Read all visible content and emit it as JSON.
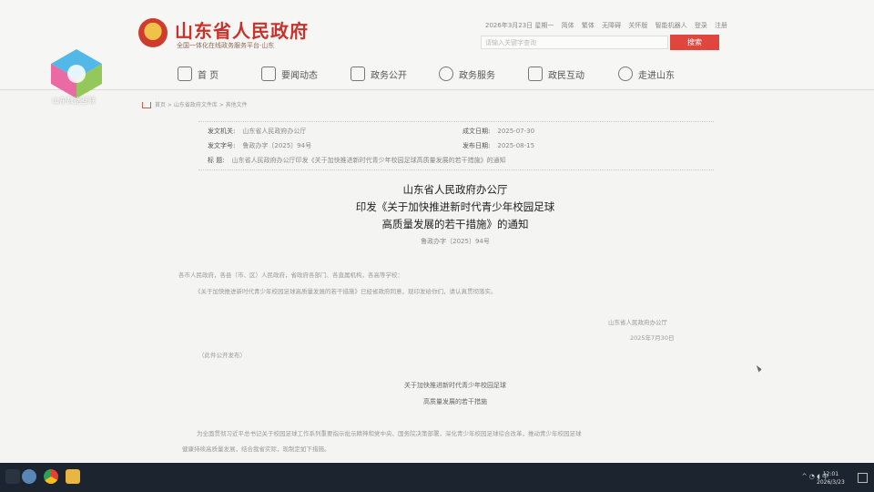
{
  "header": {
    "site_title": "山东省人民政府",
    "site_subtitle": "全国一体化在线政务服务平台·山东",
    "top_links": [
      "2026年3月23日 星期一",
      "简体",
      "繁体",
      "无障碍",
      "关怀版",
      "智能机器人",
      "登录",
      "注册"
    ],
    "search_placeholder": "请输入关键字查询",
    "search_button": "搜索"
  },
  "nav": {
    "items": [
      {
        "label": "首 页",
        "icon": "home-icon"
      },
      {
        "label": "要闻动态",
        "icon": "news-icon"
      },
      {
        "label": "政务公开",
        "icon": "document-icon"
      },
      {
        "label": "政务服务",
        "icon": "heart-icon"
      },
      {
        "label": "政民互动",
        "icon": "chat-icon"
      },
      {
        "label": "走进山东",
        "icon": "location-icon"
      }
    ]
  },
  "breadcrumb": "首页 > 山东省政府文件库 > 其他文件",
  "meta": {
    "issuer_label": "发文机关:",
    "issuer": "山东省人民政府办公厅",
    "docno_label": "发文字号:",
    "docno": "鲁政办字〔2025〕94号",
    "title_label": "标    题:",
    "title": "山东省人民政府办公厅印发《关于加快推进新时代青少年校园足球高质量发展的若干措施》的通知",
    "created_label": "成文日期:",
    "created": "2025-07-30",
    "published_label": "发布日期:",
    "published": "2025-08-15"
  },
  "document": {
    "title_lines": [
      "山东省人民政府办公厅",
      "印发《关于加快推进新时代青少年校园足球",
      "高质量发展的若干措施》的通知"
    ],
    "doc_number": "鲁政办字〔2025〕94号",
    "recipients": "各市人民政府，各县（市、区）人民政府，省政府各部门、各直属机构，各高等学校：",
    "body": "《关于加快推进新时代青少年校园足球高质量发展的若干措施》已经省政府同意，现印发给你们，请认真贯彻落实。",
    "signature": "山东省人民政府办公厅",
    "date": "2025年7月30日",
    "public_note": "（此件公开发布）",
    "attach_title_1": "关于加快推进新时代青少年校园足球",
    "attach_title_2": "高质量发展的若干措施",
    "para1": "为全面贯彻习近平总书记关于校园足球工作系列重要指示批示精神和党中央、国务院决策部署，深化青少年校园足球综合改革，推动青少年校园足球",
    "para2": "健康持续高质量发展，结合我省实际，现制定如下措施。"
  },
  "overlay": {
    "watermark_text": "山东数据互联"
  },
  "taskbar": {
    "tray_text": "中",
    "time": "12:01",
    "date": "2026/3/23"
  }
}
